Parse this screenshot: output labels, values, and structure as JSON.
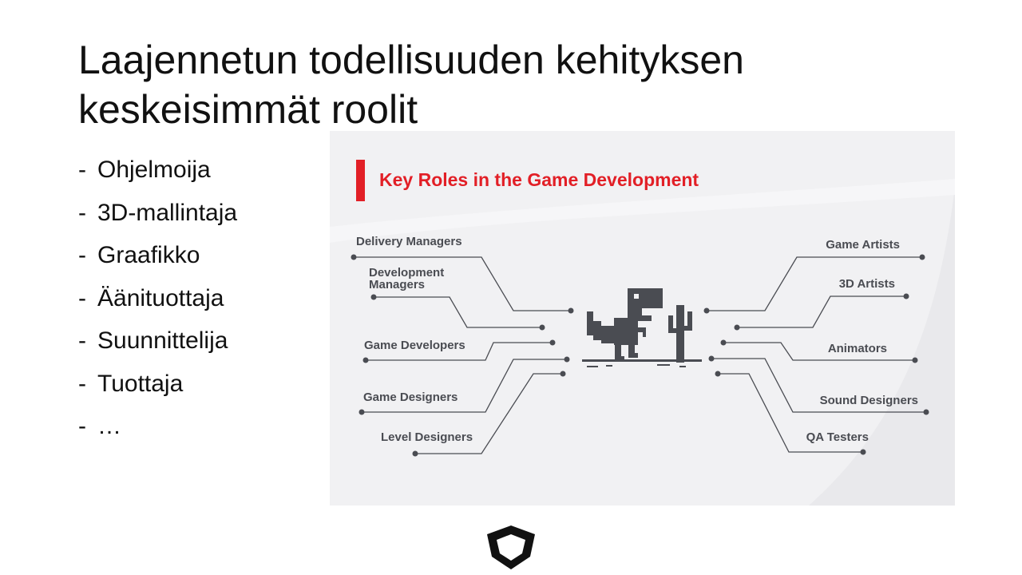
{
  "slide": {
    "title_line1": "Laajennetun todellisuuden kehityksen",
    "title_line2": "keskeisimmät roolit",
    "bullet_marker": "-",
    "bullets": [
      "Ohjelmoija",
      "3D-mallintaja",
      "Graafikko",
      "Äänituottaja",
      "Suunnittelija",
      "Tuottaja",
      "…"
    ]
  },
  "diagram": {
    "heading": "Key Roles in the Game Development",
    "left_roles": [
      "Delivery Managers",
      "Development",
      "Managers",
      "Game Developers",
      "Game Designers",
      "Level Designers"
    ],
    "right_roles": [
      "Game Artists",
      "3D Artists",
      "Animators",
      "Sound Designers",
      "QA Testers"
    ],
    "center_icon": "pixel-dinosaur-icon",
    "cactus_icon": "cactus-icon"
  },
  "colors": {
    "accent_red": "#e21f26",
    "diagram_gray": "#4a4c52",
    "diagram_background": "#f1f1f3"
  },
  "logo_icon": "shield-logo-icon"
}
